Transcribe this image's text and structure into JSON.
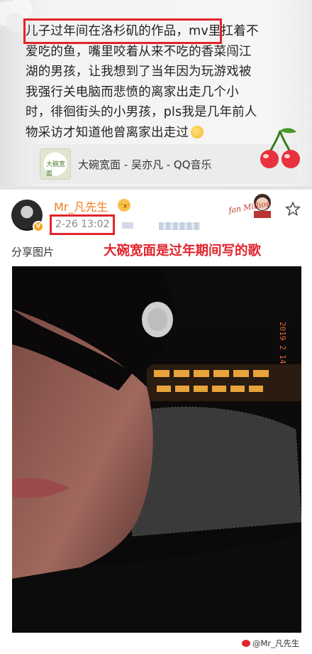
{
  "post1": {
    "text_lines": [
      "儿子过年间在洛杉矶的作品，mv里扛着不",
      "爱吃的鱼，嘴里咬着从来不吃的香菜闯江",
      "湖的男孩，让我想到了当年因为玩游戏被",
      "我强行关电脑而悲愤的离家出走几个小",
      "时，徘徊街头的小男孩，pls我是几年前人",
      "物采访才知道他曾离家出走过"
    ],
    "music_card": {
      "title": "大碗宽面 - 吴亦凡 - QQ音乐",
      "thumb_text": "大碗宽面"
    }
  },
  "post2": {
    "username": "Mr_凡先生",
    "time": "2-26 13:02",
    "share_label": "分享图片",
    "annotation": "大碗宽面是过年期间写的歌",
    "sticker_text": "fan Million",
    "photo": {
      "film_date": "2019 2 14"
    },
    "watermark": "@Mr_凡先生"
  },
  "colors": {
    "highlight_red": "#e2242c",
    "username_orange": "#f47c1f",
    "verified_badge": "#f6a31f"
  },
  "icons": [
    "cloud-icon",
    "emoji-icon",
    "cherry-icon",
    "verified-icon",
    "crown-emoji-icon",
    "star-icon",
    "weibo-logo-icon"
  ]
}
